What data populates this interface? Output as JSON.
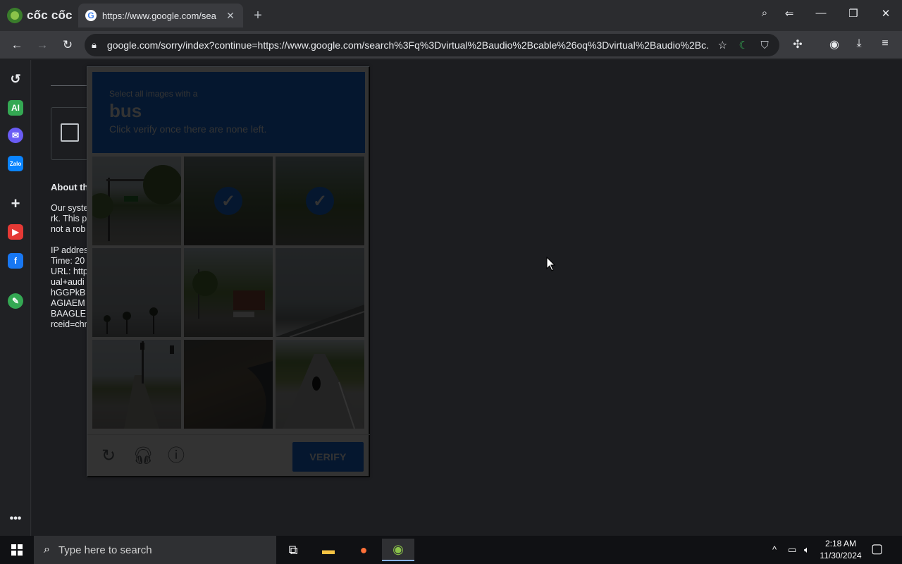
{
  "browser": {
    "brand": "cốc cốc",
    "tab": {
      "title": "https://www.google.com/sea"
    },
    "new_tab_label": "+",
    "url": "google.com/sorry/index?continue=https://www.google.com/search%3Fq%3Dvirtual%2Baudio%2Bcable%26oq%3Dvirtual%2Baudio%2Bc..."
  },
  "page": {
    "about_heading": "About th",
    "para_lines": [
      "Our syste",
      "rk. This p",
      "not a rob"
    ],
    "info_lines": [
      "IP addres",
      "Time: 20",
      "URL: http",
      "ual+audi",
      "hGGPkB",
      "AGIAEM",
      "BAAGLE",
      "rceid=chr"
    ]
  },
  "captcha": {
    "instruction_line1": "Select all images with a",
    "target": "bus",
    "instruction_line3": "Click verify once there are none left.",
    "tiles": [
      {
        "selected": false
      },
      {
        "selected": true
      },
      {
        "selected": true
      },
      {
        "selected": false
      },
      {
        "selected": false
      },
      {
        "selected": false
      },
      {
        "selected": false
      },
      {
        "selected": false
      },
      {
        "selected": false
      }
    ],
    "verify_label": "VERIFY"
  },
  "taskbar": {
    "search_placeholder": "Type here to search",
    "time": "2:18 AM",
    "date": "11/30/2024"
  },
  "colors": {
    "accent": "#1a73e8",
    "page_bg": "#1c1d20"
  }
}
